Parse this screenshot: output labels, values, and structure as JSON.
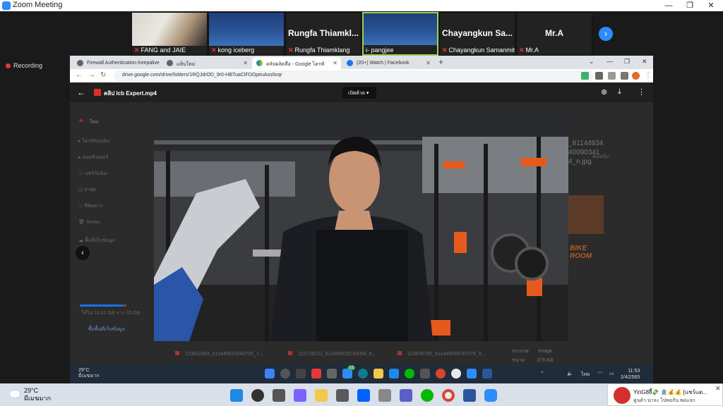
{
  "zoom": {
    "title": "Zoom Meeting",
    "recording": "Recording",
    "participants": [
      {
        "name": "FANG and JAIE",
        "muted": true
      },
      {
        "name": "kong iceberg",
        "muted": false
      },
      {
        "name": "Rungfa Thiamklang",
        "big": "Rungfa  Thiamkl...",
        "muted": true
      },
      {
        "name": "i- pangjee",
        "muted": false
      },
      {
        "name": "Chayangkun Samanmit",
        "big": "Chayangkun  Sa...",
        "muted": true
      },
      {
        "name": "Mr.A",
        "big": "Mr.A",
        "muted": true
      }
    ],
    "next": "›"
  },
  "browser": {
    "tabs": [
      {
        "label": "Firewall Authentication Keepalive",
        "color": "#5f6368"
      },
      {
        "label": "แท็บใหม่",
        "color": "#5f6368"
      },
      {
        "label": "คลิปผลิตสื่อ - Google ไดรฟ์",
        "color": "#1a73e8"
      },
      {
        "label": "(20+) Watch | Facebook",
        "color": "#1877f2"
      }
    ],
    "url": "drive.google.com/drive/folders/1RQJdrOD_9r0-HBTuaClFDOpeuAss0oqr"
  },
  "drive": {
    "file_name": "คลิป Icb Expert.mp4",
    "open_with": "เปิดด้วย",
    "sidebar": [
      "ใหม่",
      "ไดรฟ์ของฉัน",
      "คอมพิวเตอร์",
      "แชร์กับฉัน",
      "ล่าสุด",
      "ที่ติดดาว",
      "ถังขยะ",
      "พื้นที่เก็บข้อมูล"
    ],
    "storage_text": "ใช้ไป 10.41 GB จาก 15 GB",
    "buy_storage": "ซื้อพื้นที่เก็บข้อมูล",
    "right_file": "_81144934\n40090341\n4_n.jpg",
    "right_label": "ต้นฉบับ",
    "bike": "BIKE\nROOM",
    "thumbs": [
      "123632493_811449523040705_7...",
      "123729222_811449525742058_8...",
      "123635730_811449259797379_9..."
    ],
    "details": [
      "ประเภท",
      "ขนาด"
    ],
    "details_vals": [
      "Image",
      "376 KB"
    ]
  },
  "inner_taskbar": {
    "temp": "29°C",
    "cond": "มีเมฆมาก",
    "badge": "23",
    "lang": "ไทย",
    "time": "11:53",
    "date": "2/4/2565"
  },
  "taskbar": {
    "temp": "29°C",
    "cond": "มีเมฆมาก"
  },
  "toast": {
    "title": "YinG88ี้💸 🏦💰💰 [แชร์แต...",
    "sub": "คูนด้ว  น่าจะ ไปพอกัน พอแจก",
    "close": "✕"
  }
}
